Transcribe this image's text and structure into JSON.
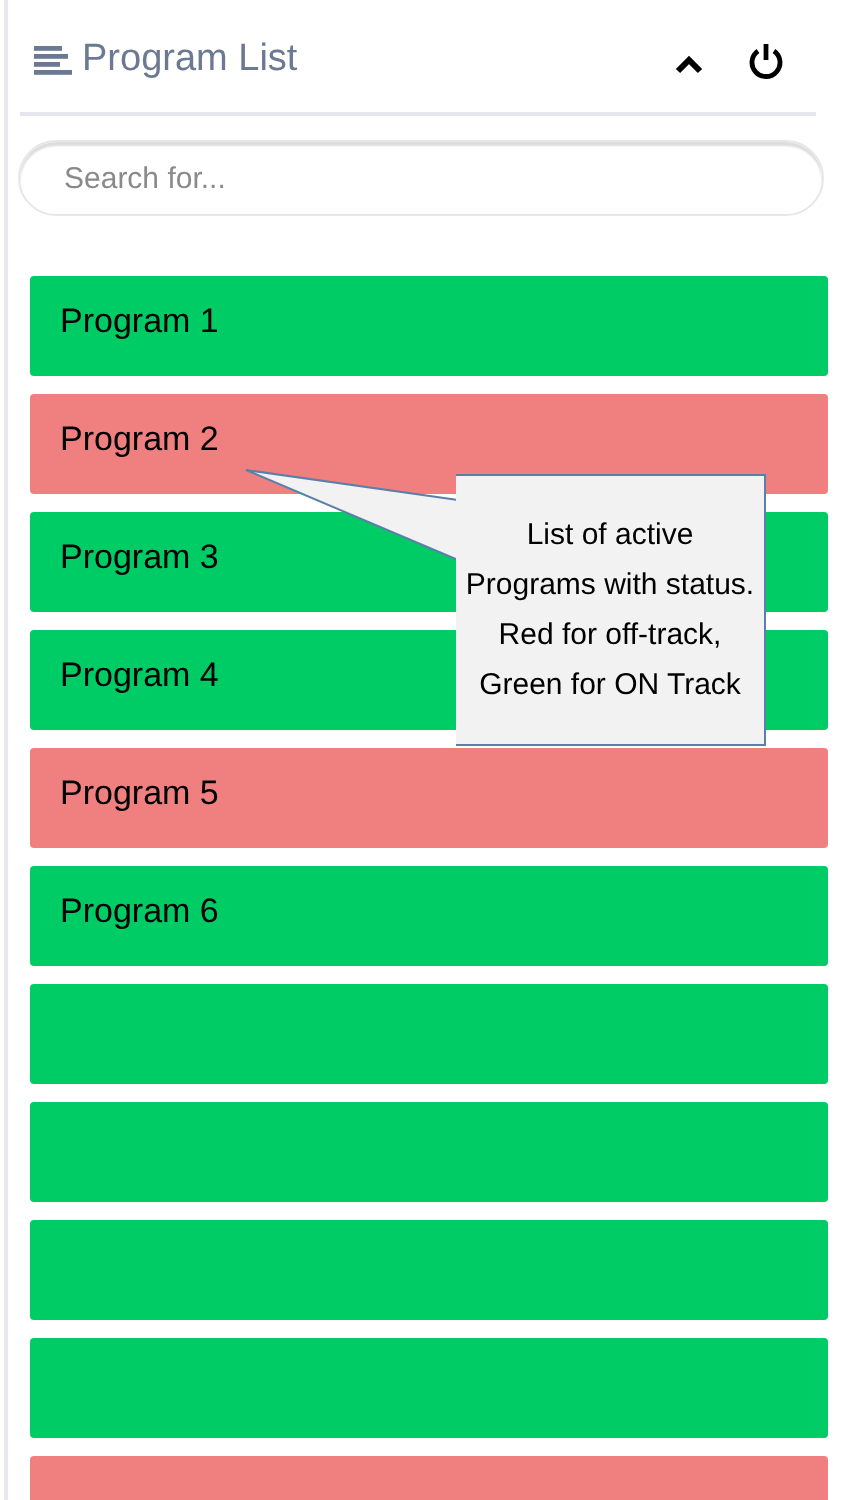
{
  "header": {
    "title": "Program List"
  },
  "search": {
    "placeholder": "Search for..."
  },
  "programs": [
    {
      "label": "Program 1",
      "color": "#00cc66"
    },
    {
      "label": "Program 2",
      "color": "#f08080"
    },
    {
      "label": "Program 3",
      "color": "#00cc66"
    },
    {
      "label": "Program 4",
      "color": "#00cc66"
    },
    {
      "label": "Program 5",
      "color": "#f08080"
    },
    {
      "label": "Program 6",
      "color": "#00cc66"
    },
    {
      "color": "#00cc66"
    },
    {
      "color": "#00cc66"
    },
    {
      "color": "#00cc66"
    },
    {
      "color": "#00cc66"
    },
    {
      "color": "#f08080"
    }
  ],
  "callout": {
    "text": "List of active Programs with status. Red for off-track, Green for ON Track"
  }
}
